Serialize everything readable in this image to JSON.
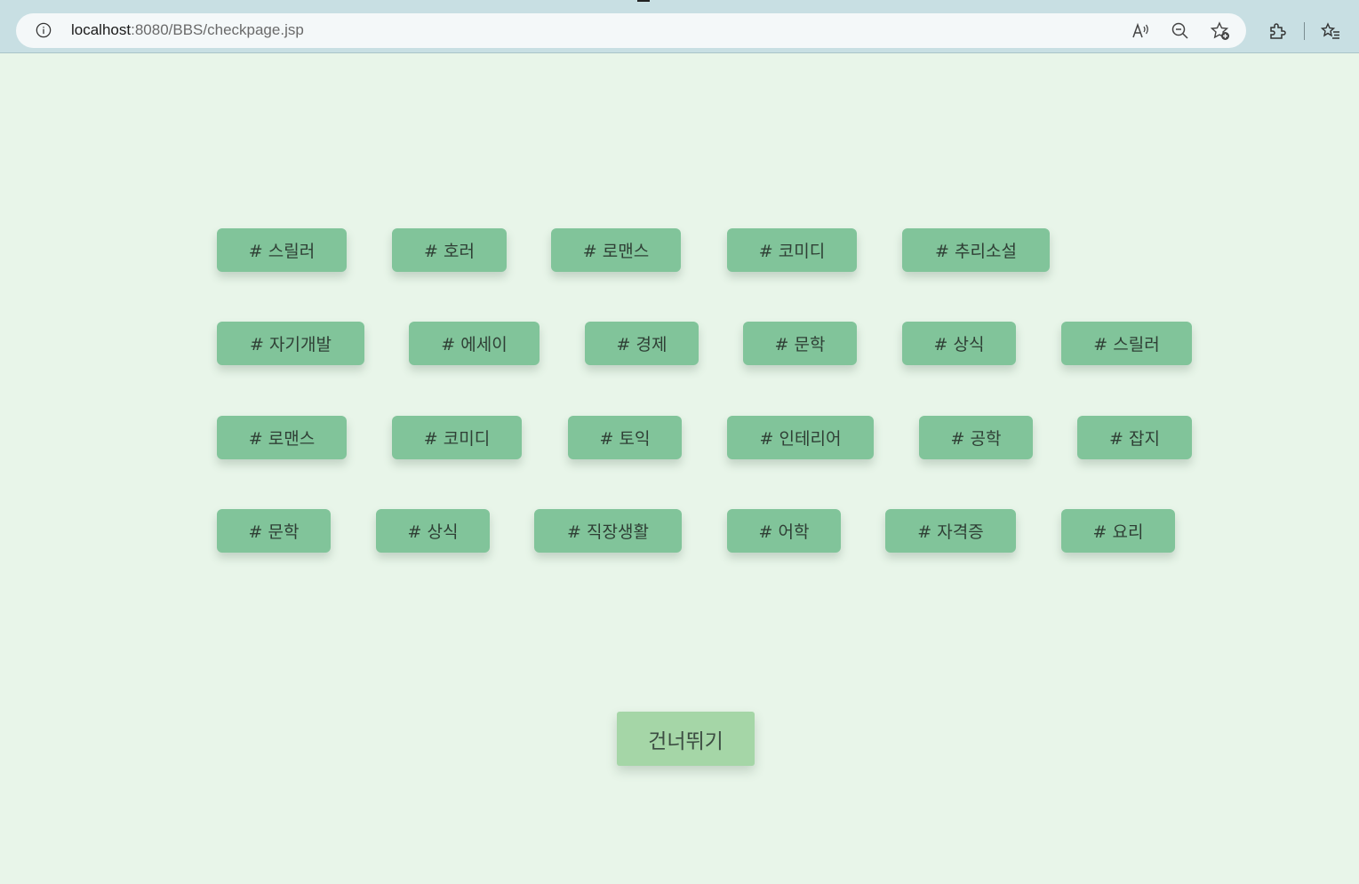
{
  "browser": {
    "url_host": "localhost",
    "url_path": ":8080/BBS/checkpage.jsp",
    "icons": [
      "info-icon",
      "read-aloud-icon",
      "zoom-out-icon",
      "add-favorite-icon",
      "extensions-icon",
      "favorites-icon"
    ]
  },
  "colors": {
    "page_background": "#e8f5e9",
    "tag_background": "#81c49a",
    "skip_background": "#a5d6a7"
  },
  "tags": [
    "# 스릴러",
    "# 호러",
    "# 로맨스",
    "# 코미디",
    "# 추리소설",
    "# 자기개발",
    "# 에세이",
    "# 경제",
    "# 문학",
    "# 상식",
    "# 스릴러",
    "# 로맨스",
    "# 코미디",
    "# 토익",
    "# 인테리어",
    "# 공학",
    "# 잡지",
    "# 문학",
    "# 상식",
    "# 직장생활",
    "# 어학",
    "# 자격증",
    "# 요리"
  ],
  "skip_button": {
    "label": "건너뛰기"
  }
}
